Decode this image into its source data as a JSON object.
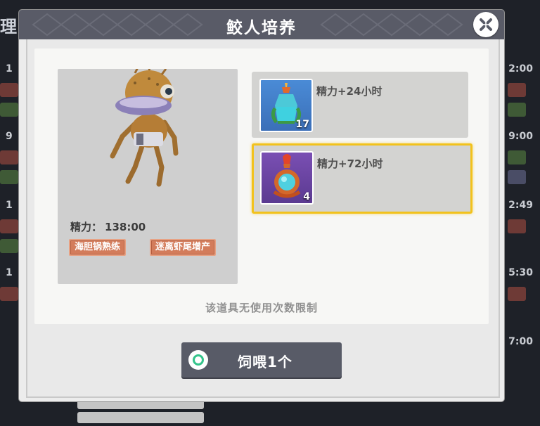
{
  "dialog": {
    "title": "鲛人培养",
    "close_icon": "close-x-icon"
  },
  "character": {
    "stamina_label": "精力：",
    "stamina_value": "138:00",
    "tags": [
      "海胆锅熟练",
      "迷离虾尾增产"
    ]
  },
  "items": [
    {
      "description": "精力+24小时",
      "count": "17",
      "icon": "green-stamina-potion-icon",
      "selected": false
    },
    {
      "description": "精力+72小时",
      "count": "4",
      "icon": "red-stamina-potion-icon",
      "selected": true
    }
  ],
  "note": "该道具无使用次数限制",
  "feed_button": {
    "label": "饲喂1个"
  },
  "colors": {
    "header": "#595b67",
    "selected_border": "#f2c21c",
    "tag": "#d37c5b",
    "radio_ring": "#34c48b"
  }
}
